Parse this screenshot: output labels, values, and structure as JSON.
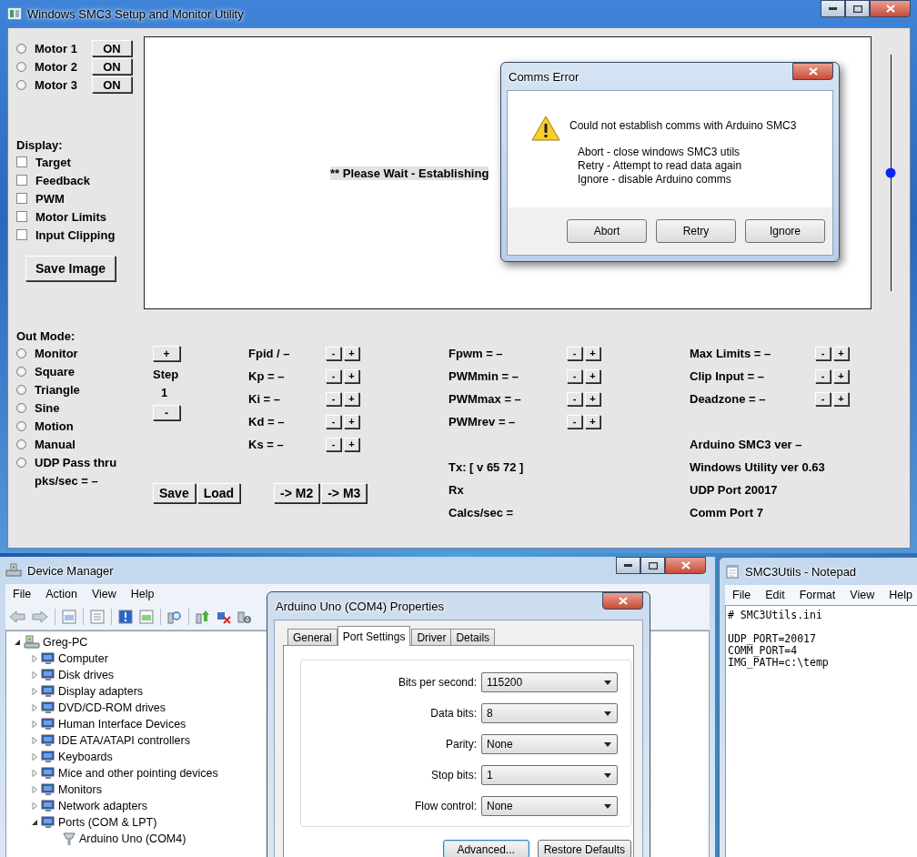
{
  "main_window": {
    "title": "Windows SMC3 Setup and Monitor Utility",
    "motors": [
      {
        "label": "Motor 1",
        "selected": false,
        "button": "ON"
      },
      {
        "label": "Motor 2",
        "selected": false,
        "button": "ON"
      },
      {
        "label": "Motor 3",
        "selected": false,
        "button": "ON"
      }
    ],
    "display": {
      "label": "Display:",
      "options": [
        {
          "label": "Target",
          "checked": false
        },
        {
          "label": "Feedback",
          "checked": false
        },
        {
          "label": "PWM",
          "checked": false
        },
        {
          "label": "Motor Limits",
          "checked": false
        },
        {
          "label": "Input Clipping",
          "checked": false
        }
      ]
    },
    "save_image": "Save Image",
    "plot": {
      "message": "** Please Wait - Establishing"
    },
    "slider": {
      "level": 0.5
    },
    "out_mode": {
      "label": "Out Mode:",
      "options": [
        {
          "label": "Monitor",
          "selected": false
        },
        {
          "label": "Square",
          "selected": false
        },
        {
          "label": "Triangle",
          "selected": false
        },
        {
          "label": "Sine",
          "selected": false
        },
        {
          "label": "Motion",
          "selected": false
        },
        {
          "label": "Manual",
          "selected": false
        },
        {
          "label": "UDP Pass thru",
          "selected": false
        }
      ],
      "rate": "pks/sec = –"
    },
    "step": {
      "increase": "+",
      "label": "Step",
      "value": "1",
      "decrease": "-"
    },
    "pid_params": [
      {
        "label": "Fpid / –",
        "decrease": "-",
        "increase": "+"
      },
      {
        "label": "Kp = –",
        "decrease": "-",
        "increase": "+"
      },
      {
        "label": "Ki = –",
        "decrease": "-",
        "increase": "+"
      },
      {
        "label": "Kd = –",
        "decrease": "-",
        "increase": "+"
      },
      {
        "label": "Ks = –",
        "decrease": "-",
        "increase": "+"
      }
    ],
    "file_buttons": [
      "Save",
      "Load"
    ],
    "copy_buttons": [
      "-> M2",
      "-> M3"
    ],
    "pwm_params": [
      {
        "label": "Fpwm = –",
        "decrease": "-",
        "increase": "+"
      },
      {
        "label": "PWMmin = –",
        "decrease": "-",
        "increase": "+"
      },
      {
        "label": "PWMmax = –",
        "decrease": "-",
        "increase": "+"
      },
      {
        "label": "PWMrev = –",
        "decrease": "-",
        "increase": "+"
      }
    ],
    "comms": [
      "Tx: [ v 65 72 ]",
      "Rx",
      "Calcs/sec ="
    ],
    "limit_params": [
      {
        "label": "Max Limits = –",
        "decrease": "-",
        "increase": "+"
      },
      {
        "label": "Clip Input = –",
        "decrease": "-",
        "increase": "+"
      },
      {
        "label": "Deadzone = –",
        "decrease": "-",
        "increase": "+"
      }
    ],
    "info": [
      "Arduino SMC3 ver –",
      "Windows Utility ver 0.63",
      "UDP Port 20017",
      "Comm Port 7"
    ]
  },
  "comms_error": {
    "title": "Comms Error",
    "message": "Could not establish comms with Arduino SMC3",
    "options": [
      "Abort - close windows SMC3 utils",
      "Retry - Attempt to read data again",
      "Ignore - disable Arduino comms"
    ],
    "buttons": [
      "Abort",
      "Retry",
      "Ignore"
    ]
  },
  "device_manager": {
    "title": "Device Manager",
    "menu": [
      "File",
      "Action",
      "View",
      "Help"
    ],
    "tree": [
      {
        "label": "Greg-PC",
        "expanded": true,
        "children": [
          {
            "label": "Computer",
            "expanded": false
          },
          {
            "label": "Disk drives",
            "expanded": false
          },
          {
            "label": "Display adapters",
            "expanded": false
          },
          {
            "label": "DVD/CD-ROM drives",
            "expanded": false
          },
          {
            "label": "Human Interface Devices",
            "expanded": false
          },
          {
            "label": "IDE ATA/ATAPI controllers",
            "expanded": false
          },
          {
            "label": "Keyboards",
            "expanded": false
          },
          {
            "label": "Mice and other pointing devices",
            "expanded": false
          },
          {
            "label": "Monitors",
            "expanded": false
          },
          {
            "label": "Network adapters",
            "expanded": false
          },
          {
            "label": "Ports (COM & LPT)",
            "expanded": true,
            "children": [
              {
                "label": "Arduino Uno (COM4)"
              }
            ]
          }
        ]
      }
    ]
  },
  "properties": {
    "title": "Arduino Uno (COM4) Properties",
    "tabs": [
      {
        "label": "General",
        "selected": false
      },
      {
        "label": "Port Settings",
        "selected": true
      },
      {
        "label": "Driver",
        "selected": false
      },
      {
        "label": "Details",
        "selected": false
      }
    ],
    "fields": [
      {
        "label": "Bits per second:",
        "value": "115200"
      },
      {
        "label": "Data bits:",
        "value": "8"
      },
      {
        "label": "Parity:",
        "value": "None"
      },
      {
        "label": "Stop bits:",
        "value": "1"
      },
      {
        "label": "Flow control:",
        "value": "None"
      }
    ],
    "buttons": [
      "Advanced...",
      "Restore Defaults"
    ]
  },
  "notepad": {
    "title": "SMC3Utils - Notepad",
    "menu": [
      "File",
      "Edit",
      "Format",
      "View",
      "Help"
    ],
    "text": "# SMC3Utils.ini\n\nUDP_PORT=20017\nCOMM_PORT=4\nIMG_PATH=c:\\temp"
  }
}
